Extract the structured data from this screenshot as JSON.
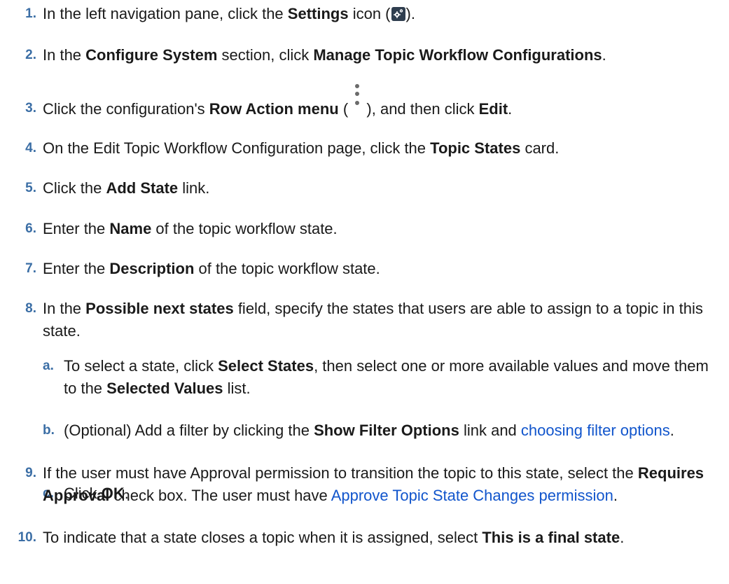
{
  "steps": [
    {
      "num": "1",
      "parts": [
        {
          "t": "In the left navigation pane, click the "
        },
        {
          "t": "Settings",
          "b": true
        },
        {
          "t": " icon ("
        },
        {
          "icon": "settings-icon"
        },
        {
          "t": ")."
        }
      ]
    },
    {
      "num": "2",
      "parts": [
        {
          "t": "In the "
        },
        {
          "t": "Configure System",
          "b": true
        },
        {
          "t": " section, click "
        },
        {
          "t": "Manage Topic Workflow Configurations",
          "b": true
        },
        {
          "t": "."
        }
      ]
    },
    {
      "num": "3",
      "parts": [
        {
          "t": "Click the configuration's "
        },
        {
          "t": "Row Action menu",
          "b": true
        },
        {
          "t": " ( "
        },
        {
          "icon": "kebab-menu-icon"
        },
        {
          "t": " ), and then click "
        },
        {
          "t": "Edit",
          "b": true
        },
        {
          "t": "."
        }
      ]
    },
    {
      "num": "4",
      "parts": [
        {
          "t": "On the Edit Topic Workflow Configuration page, click the "
        },
        {
          "t": "Topic States",
          "b": true
        },
        {
          "t": " card."
        }
      ]
    },
    {
      "num": "5",
      "parts": [
        {
          "t": "Click the "
        },
        {
          "t": "Add State",
          "b": true
        },
        {
          "t": " link."
        }
      ]
    },
    {
      "num": "6",
      "parts": [
        {
          "t": "Enter the "
        },
        {
          "t": "Name",
          "b": true
        },
        {
          "t": " of the topic workflow state."
        }
      ]
    },
    {
      "num": "7",
      "parts": [
        {
          "t": "Enter the "
        },
        {
          "t": "Description",
          "b": true
        },
        {
          "t": " of the topic workflow state."
        }
      ]
    },
    {
      "num": "8",
      "parts": [
        {
          "t": "In the "
        },
        {
          "t": "Possible next states",
          "b": true
        },
        {
          "t": " field, specify the states that users are able to assign to a topic in this state."
        }
      ],
      "substeps": [
        {
          "num": "a",
          "parts": [
            {
              "t": "To select a state, click "
            },
            {
              "t": "Select States",
              "b": true
            },
            {
              "t": ", then select one or more available values and move them to the "
            },
            {
              "t": "Selected Values",
              "b": true
            },
            {
              "t": " list."
            }
          ]
        },
        {
          "num": "b",
          "parts": [
            {
              "t": "(Optional) Add a filter by clicking the "
            },
            {
              "t": "Show Filter Options",
              "b": true
            },
            {
              "t": " link and "
            },
            {
              "t": "choosing filter options",
              "link": true
            },
            {
              "t": "."
            }
          ]
        },
        {
          "num": "c",
          "parts": [
            {
              "t": "Click "
            },
            {
              "t": "OK",
              "b": true
            },
            {
              "t": "."
            }
          ]
        }
      ]
    },
    {
      "num": "9",
      "parts": [
        {
          "t": "If the user must have Approval permission to transition the topic to this state, select the "
        },
        {
          "t": "Requires Approval",
          "b": true
        },
        {
          "t": " check box. The user must have "
        },
        {
          "t": "Approve Topic State Changes permission",
          "link": true
        },
        {
          "t": "."
        }
      ]
    },
    {
      "num": "10",
      "parts": [
        {
          "t": "To indicate that a state closes a topic when it is assigned, select "
        },
        {
          "t": "This is a final state",
          "b": true
        },
        {
          "t": "."
        }
      ]
    }
  ]
}
